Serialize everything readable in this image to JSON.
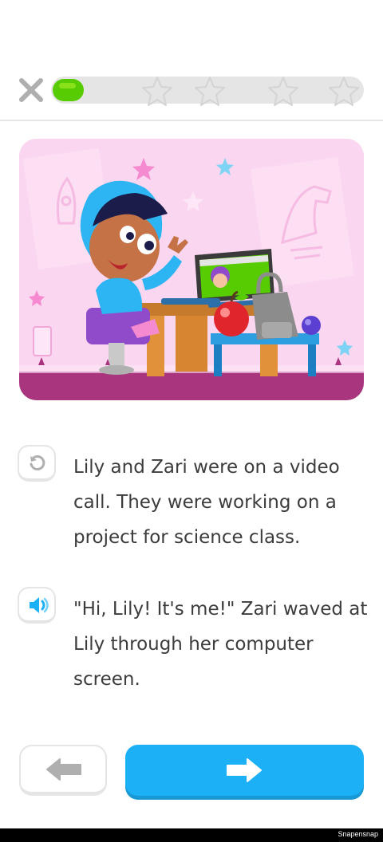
{
  "progress": {
    "percent": 10
  },
  "colors": {
    "accent": "#1cb0f6",
    "progress": "#58cc02",
    "track": "#e5e5e5",
    "illustration_bg": "#fbd6f0",
    "floor": "#a8357e"
  },
  "icons": {
    "close": "close-icon",
    "star": "star-icon",
    "replay": "replay-icon",
    "speaker": "speaker-icon",
    "back": "arrow-left-icon",
    "next": "arrow-right-icon"
  },
  "story": {
    "lines": [
      {
        "icon": "replay-icon",
        "text": "Lily and Zari were on a video call. They were working on a project for science class."
      },
      {
        "icon": "speaker-icon",
        "text": "\"Hi, Lily! It's me!\" Zari waved at Lily through her computer screen."
      }
    ]
  },
  "footer": {
    "watermark": "Snapensnap"
  }
}
